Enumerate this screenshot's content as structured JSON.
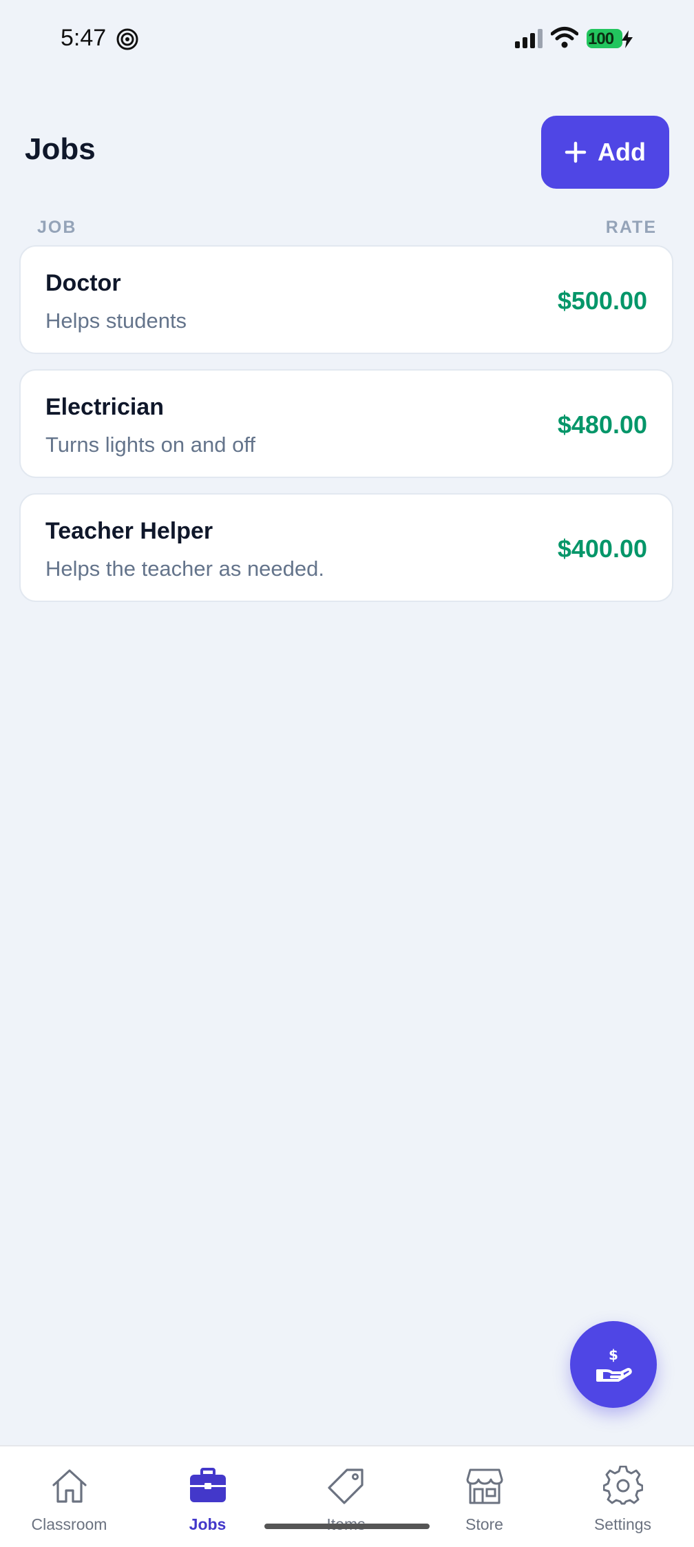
{
  "status_bar": {
    "time": "5:47",
    "battery": "100"
  },
  "header": {
    "title": "Jobs",
    "add_label": "Add"
  },
  "columns": {
    "job": "JOB",
    "rate": "RATE"
  },
  "jobs": [
    {
      "title": "Doctor",
      "description": "Helps students",
      "rate": "$500.00"
    },
    {
      "title": "Electrician",
      "description": "Turns lights on and off",
      "rate": "$480.00"
    },
    {
      "title": "Teacher Helper",
      "description": "Helps the teacher as needed.",
      "rate": "$400.00"
    }
  ],
  "nav": [
    {
      "label": "Classroom",
      "icon": "house-icon"
    },
    {
      "label": "Jobs",
      "icon": "briefcase-icon",
      "active": true
    },
    {
      "label": "Items",
      "icon": "tag-icon"
    },
    {
      "label": "Store",
      "icon": "store-icon"
    },
    {
      "label": "Settings",
      "icon": "gear-icon"
    }
  ],
  "fab": {
    "icon": "hand-dollar-icon"
  },
  "colors": {
    "accent": "#4f46e5",
    "rate": "#059669",
    "background": "#eff3f9"
  }
}
